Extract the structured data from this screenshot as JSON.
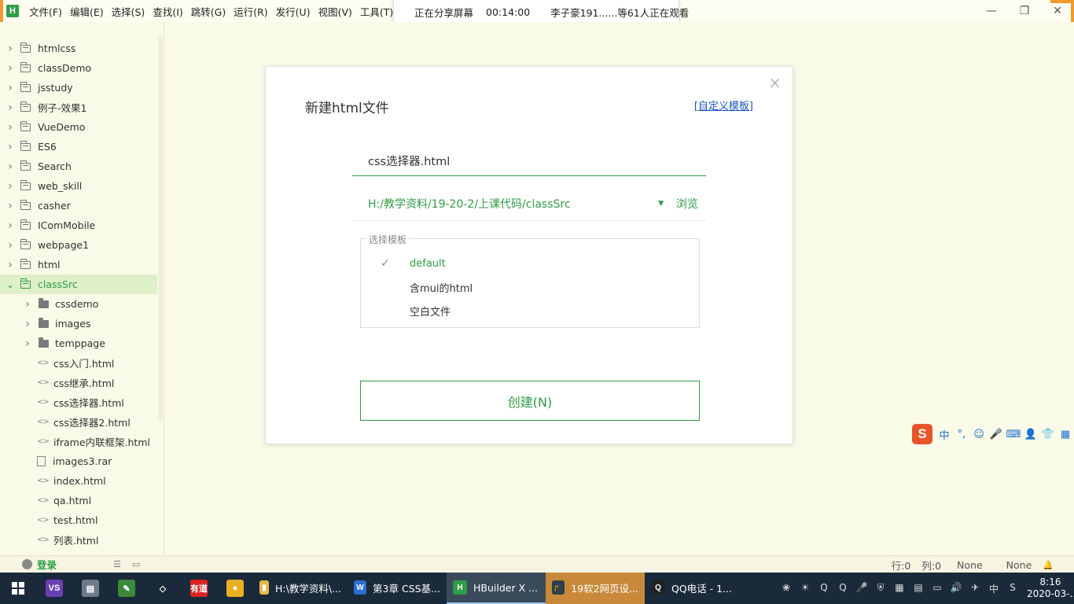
{
  "menubar": {
    "logo": "H",
    "items": [
      "文件(F)",
      "编辑(E)",
      "选择(S)",
      "查找(I)",
      "跳转(G)",
      "运行(R)",
      "发行(U)",
      "视图(V)",
      "工具(T)"
    ],
    "controls": [
      "—",
      "❐",
      "✕"
    ]
  },
  "share_banner": {
    "status": "正在分享屏幕",
    "elapsed": "00:14:00",
    "viewers": "李子豪191......等61人正在观看"
  },
  "sidebar": {
    "items": [
      {
        "label": "htmlcss",
        "type": "folder",
        "depth": 0,
        "expanded": false
      },
      {
        "label": "classDemo",
        "type": "folder",
        "depth": 0,
        "expanded": false
      },
      {
        "label": "jsstudy",
        "type": "folder",
        "depth": 0,
        "expanded": false
      },
      {
        "label": "例子-效果1",
        "type": "folder",
        "depth": 0,
        "expanded": false
      },
      {
        "label": "VueDemo",
        "type": "folder",
        "depth": 0,
        "expanded": false
      },
      {
        "label": "ES6",
        "type": "folder",
        "depth": 0,
        "expanded": false
      },
      {
        "label": "Search",
        "type": "folder",
        "depth": 0,
        "expanded": false
      },
      {
        "label": "web_skill",
        "type": "folder",
        "depth": 0,
        "expanded": false
      },
      {
        "label": "casher",
        "type": "folder",
        "depth": 0,
        "expanded": false
      },
      {
        "label": "IComMobile",
        "type": "folder",
        "depth": 0,
        "expanded": false
      },
      {
        "label": "webpage1",
        "type": "folder",
        "depth": 0,
        "expanded": false
      },
      {
        "label": "html",
        "type": "folder",
        "depth": 0,
        "expanded": false
      },
      {
        "label": "classSrc",
        "type": "folder",
        "depth": 0,
        "expanded": true,
        "selected": true
      },
      {
        "label": "cssdemo",
        "type": "subfolder",
        "depth": 1
      },
      {
        "label": "images",
        "type": "subfolder",
        "depth": 1
      },
      {
        "label": "temppage",
        "type": "subfolder",
        "depth": 1
      },
      {
        "label": "css入门.html",
        "type": "code",
        "depth": 1
      },
      {
        "label": "css继承.html",
        "type": "code",
        "depth": 1
      },
      {
        "label": "css选择器.html",
        "type": "code",
        "depth": 1
      },
      {
        "label": "css选择器2.html",
        "type": "code",
        "depth": 1
      },
      {
        "label": "iframe内联框架.html",
        "type": "code",
        "depth": 1
      },
      {
        "label": "images3.rar",
        "type": "file",
        "depth": 1
      },
      {
        "label": "index.html",
        "type": "code",
        "depth": 1
      },
      {
        "label": "qa.html",
        "type": "code",
        "depth": 1
      },
      {
        "label": "test.html",
        "type": "code",
        "depth": 1
      },
      {
        "label": "列表.html",
        "type": "code",
        "depth": 1
      }
    ]
  },
  "dialog": {
    "title": "新建html文件",
    "custom_template_prefix": "[",
    "custom_template_link": "自定义模板",
    "custom_template_suffix": "]",
    "close": "×",
    "filename_value": "css选择器.html",
    "path_value": "H:/教学资料/19-20-2/上课代码/classSrc",
    "path_dropdown": "▼",
    "browse_label": "浏览",
    "template_legend": "选择模板",
    "templates": [
      {
        "label": "default",
        "checked": true
      },
      {
        "label": "含mui的html",
        "checked": false
      },
      {
        "label": "空白文件",
        "checked": false
      }
    ],
    "check_mark": "✓",
    "create_label": "创建(N)"
  },
  "ime": {
    "logo": "S",
    "items": [
      "中",
      "°,",
      "☺",
      "🎤",
      "⌨",
      "👤",
      "👕",
      "▦"
    ]
  },
  "statusbar": {
    "login": "登录",
    "line": "行:0",
    "col": "列:0",
    "encoding": "None",
    "syntax": "None",
    "bell": "🔔"
  },
  "taskbar": {
    "apps": [
      {
        "label": "H:\\教学资料\\...",
        "color": "#e8b84a",
        "glyph": "▮"
      },
      {
        "label": "第3章 CSS基...",
        "color": "#2a6fd0",
        "glyph": "W"
      },
      {
        "label": "HBuilder X ...",
        "color": "#2e9d47",
        "glyph": "H",
        "active": true
      },
      {
        "label": "19软2网页设...",
        "color": "#2f3e4e",
        "glyph": "🎓",
        "highlight": true
      },
      {
        "label": "QQ电话 - 1...",
        "color": "#222",
        "glyph": "Q"
      }
    ],
    "pinned": [
      {
        "name": "visual-studio",
        "color": "#6a3fb5",
        "glyph": "VS"
      },
      {
        "name": "printer",
        "color": "#6c7a8a",
        "glyph": "▤"
      },
      {
        "name": "image-tool",
        "color": "#3a8a3a",
        "glyph": "✎"
      },
      {
        "name": "3d-box",
        "color": "#1a2a3a",
        "glyph": "◇"
      },
      {
        "name": "youdao",
        "color": "#d22",
        "glyph": "有道"
      },
      {
        "name": "chrome",
        "color": "#e8b020",
        "glyph": "●"
      }
    ],
    "tray": [
      "❀",
      "☀",
      "Q",
      "Q",
      "🎤",
      "⛨",
      "▦",
      "▤",
      "▭",
      "🔊",
      "✈",
      "中",
      "S"
    ],
    "time": "8:16",
    "date": "2020-03-..."
  }
}
